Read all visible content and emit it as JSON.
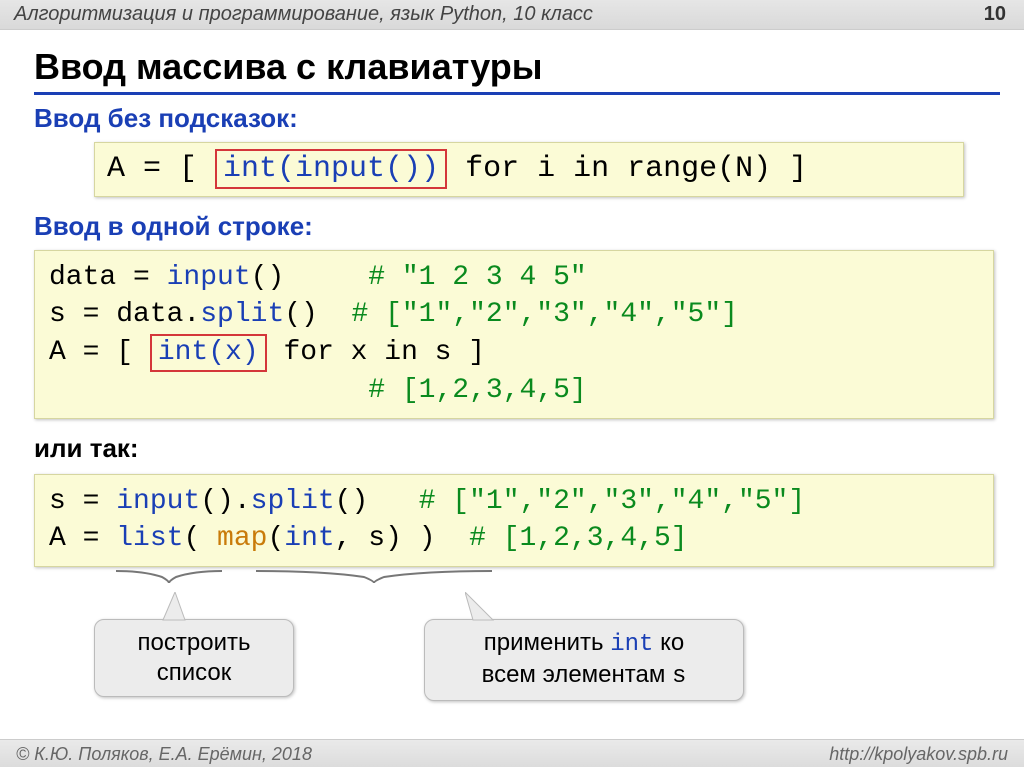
{
  "header": {
    "course": "Алгоритмизация и программирование, язык Python, 10 класс",
    "page": "10"
  },
  "title": "Ввод массива с клавиатуры",
  "sec1": {
    "heading": "Ввод без подсказок:"
  },
  "code1": {
    "p1": "A = [ ",
    "red": "int(input())",
    "p2": " for i in range(N) ]"
  },
  "sec2": {
    "heading": "Ввод в одной строке:"
  },
  "code2": {
    "l1a": "data = ",
    "l1b": "input",
    "l1c": "()     ",
    "l1d": "# \"1 2 3 4 5\"",
    "l2a": "s = data.",
    "l2b": "split",
    "l2c": "()  ",
    "l2d": "# [\"1\",\"2\",\"3\",\"4\",\"5\"]",
    "l3a": "A = [ ",
    "l3red": "int(x)",
    "l3b": " for x in s ]",
    "l4pad": "                   ",
    "l4": "# [1,2,3,4,5]"
  },
  "sec3": {
    "heading": "или так:"
  },
  "code3": {
    "l1a": "s = ",
    "l1b": "input",
    "l1c": "().",
    "l1d": "split",
    "l1e": "()   ",
    "l1f": "# [\"1\",\"2\",\"3\",\"4\",\"5\"]",
    "l2a": "A = ",
    "l2b": "list",
    "l2c": "( ",
    "l2d": "map",
    "l2e": "(",
    "l2f": "int",
    "l2g": ", s) )  ",
    "l2h": "# [1,2,3,4,5]"
  },
  "bubble1": {
    "l1": "построить",
    "l2": "список"
  },
  "bubble2": {
    "l1": "применить ",
    "l1b": "int",
    "l1c": " ко",
    "l2": "всем элементам ",
    "l2b": "s"
  },
  "footer": {
    "left": "© К.Ю. Поляков, Е.А. Ерёмин, 2018",
    "right": "http://kpolyakov.spb.ru"
  }
}
